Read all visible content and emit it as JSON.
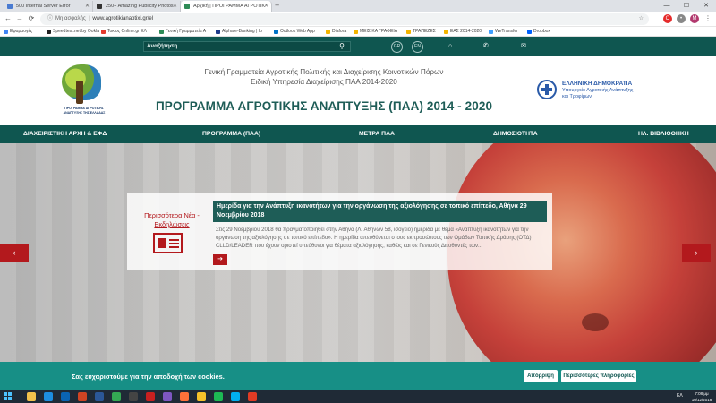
{
  "browser": {
    "tabs": [
      {
        "title": "500 Internal Server Error",
        "color": "#4a7bd1"
      },
      {
        "title": "250+ Amazing Publicity Photos",
        "color": "#333333"
      },
      {
        "title": "Αρχική | ΠΡΟΓΡΑΜΜΑ ΑΓΡΟΤΙΚ",
        "color": "#2e8b57"
      }
    ],
    "new_tab": "+",
    "window_controls": [
      "—",
      "☐",
      "✕"
    ],
    "address": {
      "secure_label": "Μη ασφαλής",
      "url": "www.agrotikianaptixi.gr/el"
    },
    "bookmarks": [
      {
        "label": "Εφαρμογές",
        "color": "#4285f4"
      },
      {
        "label": "Speedtest.net by Ookla",
        "color": "#222222"
      },
      {
        "label": "Τοκιος Online.gr ΕΛ",
        "color": "#e33b2e"
      },
      {
        "label": "Γενική Γραμματεία Α",
        "color": "#2e8b57"
      },
      {
        "label": "Alpha e-Banking | Ιο",
        "color": "#1e3a8a"
      },
      {
        "label": "Outlook Web App",
        "color": "#0072c6"
      },
      {
        "label": "Diafora",
        "color": "#f4b400"
      },
      {
        "label": "ΜΕΙΣΙΚΑ ΓΡΑΦΕΙΑ",
        "color": "#f4b400"
      },
      {
        "label": "ΤΡΑΠΕΖΕΣ",
        "color": "#f4b400"
      },
      {
        "label": "ΕΑΣ 2014-2020",
        "color": "#f4b400"
      },
      {
        "label": "WeTransfer",
        "color": "#409fff"
      },
      {
        "label": "Dropbox",
        "color": "#0061fe"
      }
    ]
  },
  "site": {
    "search_placeholder": "Αναζήτηση",
    "lang": [
      "GR",
      "EN"
    ],
    "header": {
      "subtitle1": "Γενική Γραμματεία Αγροτικής Πολιτικής και Διαχείρισης Κοινοτικών Πόρων",
      "subtitle2": "Ειδική Υπηρεσία Διαχείρισης ΠΑΑ 2014-2020",
      "title": "ΠΡΟΓΡΑΜΜΑ ΑΓΡΟΤΙΚΗΣ ΑΝΑΠΤΥΞΗΣ (ΠΑΑ) 2014 - 2020",
      "logo_caption": "ΠΡΟΓΡΑΜΜΑ ΑΓΡΟΤΙΚΗΣ ΑΝΑΠΤΥΞΗΣ ΤΗΣ ΕΛΛΑΔΑΣ",
      "gov_line1": "ΕΛΛΗΝΙΚΗ ΔΗΜΟΚΡΑΤΙΑ",
      "gov_line2": "Υπουργείο Αγροτικής Ανάπτυξης",
      "gov_line3": "και Τροφίμων"
    },
    "nav": [
      "ΔΙΑΧΕΙΡΙΣΤΙΚΗ ΑΡΧΗ & ΕΦΔ",
      "ΠΡΟΓΡΑΜΜΑ (ΠΑΑ)",
      "ΜΕΤΡΑ ΠΑΑ",
      "ΔΗΜΟΣΙΟΤΗΤΑ",
      "ΗΛ. ΒΙΒΛΙΟΘΗΚΗ"
    ],
    "news": {
      "more_label": "Περισσότερα Νέα - Εκδηλώσεις",
      "title": "Ημερίδα για την Ανάπτυξη ικανοτήτων για την οργάνωση της αξιολόγησης σε τοπικό επίπεδο, Αθήνα 29 Νοεμβρίου 2018",
      "body": "Στις 29 Νοεμβρίου 2018 θα πραγματοποιηθεί στην Αθήνα (Λ. Αθηνών 58, ισόγειο) ημερίδα με θέμα «Ανάπτυξη ικανοτήτων για την οργάνωση της αξιολόγησης σε τοπικό επίπεδο». Η ημερίδα απευθύνεται στους εκπροσώπους των Ομάδων Τοπικής Δράσης (ΟΤΔ) CLLD/LEADER που έχουν οριστεί υπεύθυνοι για θέματα αξιολόγησης, καθώς και σε Γενικούς Διευθυντές των..."
    },
    "cookie": {
      "text": "Σας ευχαριστούμε για την αποδοχή των cookies.",
      "decline": "Απόρριψη",
      "more": "Περισσότερες πληροφορίες"
    }
  },
  "taskbar": {
    "apps": [
      {
        "name": "file-explorer",
        "color": "#f2c24c"
      },
      {
        "name": "edge",
        "color": "#1d8ee0"
      },
      {
        "name": "outlook",
        "color": "#0a64b4"
      },
      {
        "name": "powerpoint",
        "color": "#d04423"
      },
      {
        "name": "word",
        "color": "#2b5797"
      },
      {
        "name": "chrome",
        "color": "#34a853"
      },
      {
        "name": "app-dark",
        "color": "#444444"
      },
      {
        "name": "app-red",
        "color": "#c82020"
      },
      {
        "name": "app-purple",
        "color": "#7e57c2"
      },
      {
        "name": "firefox",
        "color": "#ff7139"
      },
      {
        "name": "app-yellow",
        "color": "#f6c22a"
      },
      {
        "name": "spotify",
        "color": "#1db954"
      },
      {
        "name": "skype",
        "color": "#00aff0"
      },
      {
        "name": "acrobat",
        "color": "#e03b24"
      }
    ],
    "lang": "ΕΛ",
    "time": "7:08 μμ",
    "date": "10/12/2018"
  }
}
